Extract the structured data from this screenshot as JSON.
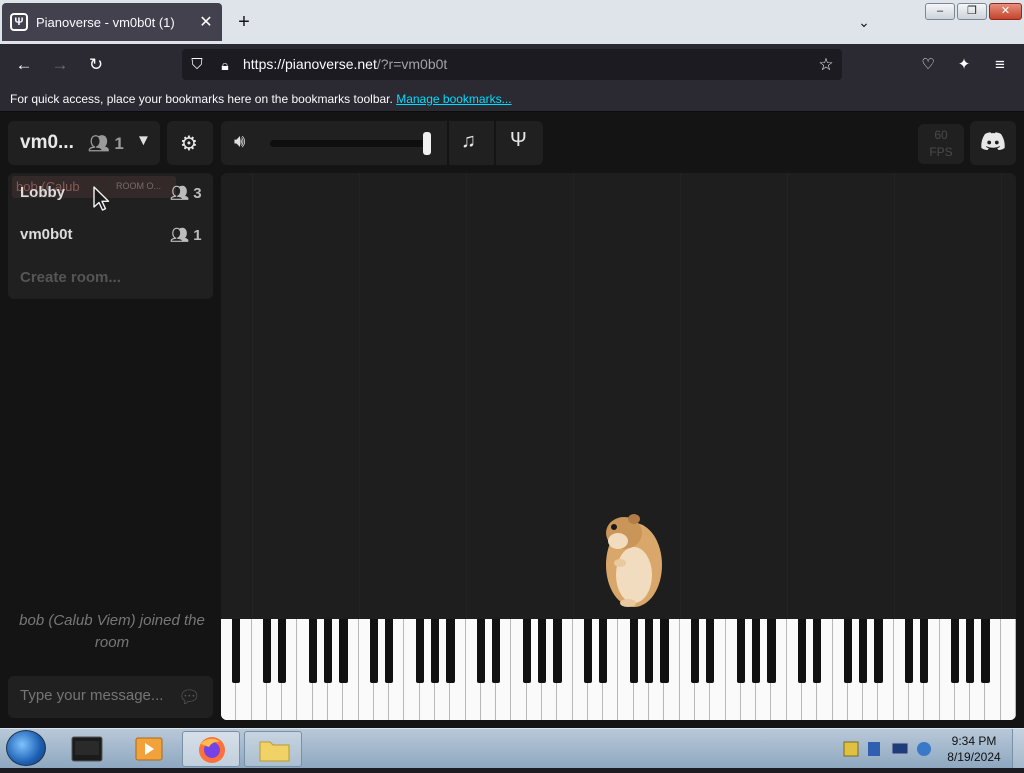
{
  "browser": {
    "tab_title": "Pianoverse - vm0b0t (1)",
    "tab_close": "✕",
    "new_tab": "+",
    "url_host": "https://pianoverse.net",
    "url_path": "/?r=vm0b0t",
    "bookmarks_message": "For quick access, place your bookmarks here on the bookmarks toolbar.",
    "bookmarks_link": "Manage bookmarks..."
  },
  "app": {
    "current_room": "vm0...",
    "current_room_users": "1",
    "fps_value": "60",
    "fps_label": "FPS",
    "volume_level": 0.98,
    "rooms": [
      {
        "name": "Lobby",
        "users": "3"
      },
      {
        "name": "vm0b0t",
        "users": "1"
      }
    ],
    "create_room_placeholder": "Create room...",
    "lobby_tooltip_name": "bob (Calub",
    "lobby_tooltip_room": "ROOM O...",
    "chat_message": "bob (Calub Viem) joined the room",
    "chat_placeholder": "Type your message..."
  },
  "piano": {
    "white_keys": 52
  },
  "taskbar": {
    "time": "9:34 PM",
    "date": "8/19/2024"
  },
  "colors": {
    "background": "#141414",
    "panel": "#202020",
    "link": "#00ddff"
  }
}
